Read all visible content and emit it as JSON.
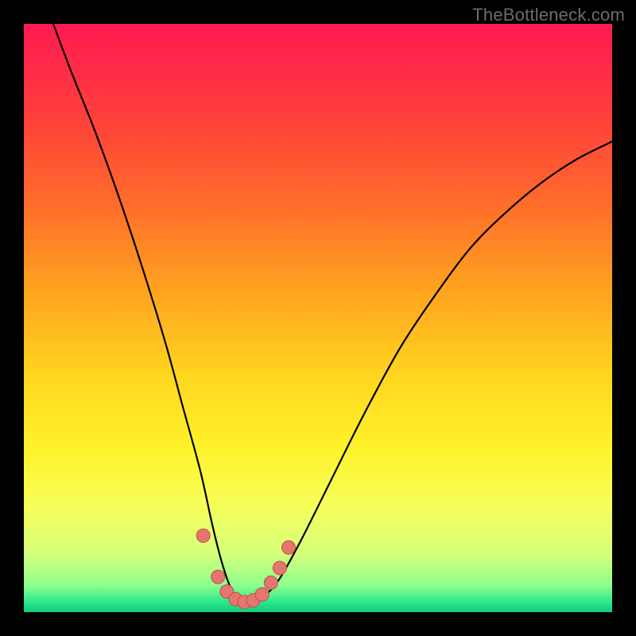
{
  "watermark": "TheBottleneck.com",
  "colors": {
    "frame": "#000000",
    "curve": "#000000",
    "marker_fill": "#e4766f",
    "marker_stroke": "#c34f48",
    "gradient_stops": [
      {
        "offset": 0.0,
        "color": "#ff1a52"
      },
      {
        "offset": 0.15,
        "color": "#ff3d3d"
      },
      {
        "offset": 0.3,
        "color": "#ff6a2a"
      },
      {
        "offset": 0.45,
        "color": "#ffa21f"
      },
      {
        "offset": 0.6,
        "color": "#ffd61f"
      },
      {
        "offset": 0.72,
        "color": "#fff22a"
      },
      {
        "offset": 0.82,
        "color": "#f6ff5a"
      },
      {
        "offset": 0.9,
        "color": "#d6ff7a"
      },
      {
        "offset": 0.955,
        "color": "#8dff8d"
      },
      {
        "offset": 0.985,
        "color": "#25e58a"
      },
      {
        "offset": 1.0,
        "color": "#13c97a"
      }
    ]
  },
  "chart_data": {
    "type": "line",
    "title": "",
    "xlabel": "",
    "ylabel": "",
    "xlim": [
      0,
      100
    ],
    "ylim": [
      0,
      100
    ],
    "series": [
      {
        "name": "bottleneck-curve",
        "x": [
          5,
          8,
          12,
          16,
          20,
          24,
          27,
          30,
          32,
          33.5,
          35,
          36.5,
          38,
          40,
          43,
          47,
          52,
          58,
          64,
          70,
          76,
          82,
          88,
          94,
          100
        ],
        "y": [
          100,
          92,
          82,
          71,
          59,
          46,
          35,
          24,
          15,
          9,
          4.5,
          2.2,
          1.5,
          2.2,
          5,
          12,
          22,
          34,
          45,
          54,
          62,
          68,
          73,
          77,
          80
        ]
      }
    ],
    "markers": {
      "name": "highlight-points",
      "x": [
        30.5,
        33,
        34.5,
        36,
        37.5,
        39,
        40.5,
        42,
        43.5,
        45
      ],
      "y": [
        13,
        6,
        3.5,
        2.2,
        1.7,
        2.0,
        3.0,
        5.0,
        7.5,
        11
      ]
    }
  }
}
